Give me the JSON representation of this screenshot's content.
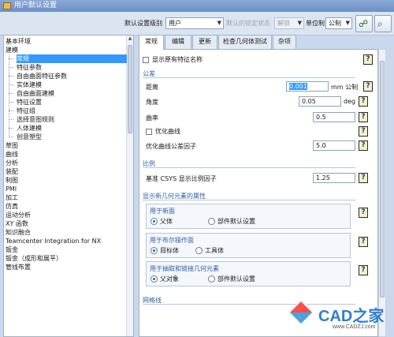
{
  "window": {
    "title": "用户默认设置"
  },
  "toolbar": {
    "level_label": "默认设置级别",
    "level_value": "用户",
    "lock_label": "默认的锁定状态",
    "lock_value": "解锁",
    "unit_label": "单位制",
    "unit_value": "公制"
  },
  "tree": {
    "items": [
      {
        "label": "基本环境",
        "level": 0
      },
      {
        "label": "建模",
        "level": 0
      },
      {
        "label": "常规",
        "level": 1,
        "selected": true
      },
      {
        "label": "特征参数",
        "level": 1
      },
      {
        "label": "自由曲面特征参数",
        "level": 1
      },
      {
        "label": "实体建模",
        "level": 1
      },
      {
        "label": "自由曲面建模",
        "level": 1
      },
      {
        "label": "特征设置",
        "level": 1
      },
      {
        "label": "特征组",
        "level": 1
      },
      {
        "label": "选择意图规则",
        "level": 1
      },
      {
        "label": "人体建模",
        "level": 1
      },
      {
        "label": "创意塑型",
        "level": 1
      },
      {
        "label": "草图",
        "level": 0
      },
      {
        "label": "曲线",
        "level": 0
      },
      {
        "label": "分析",
        "level": 0
      },
      {
        "label": "装配",
        "level": 0
      },
      {
        "label": "制图",
        "level": 0
      },
      {
        "label": "PMI",
        "level": 0
      },
      {
        "label": "加工",
        "level": 0
      },
      {
        "label": "仿真",
        "level": 0
      },
      {
        "label": "运动分析",
        "level": 0
      },
      {
        "label": "XY 函数",
        "level": 0
      },
      {
        "label": "知识融合",
        "level": 0
      },
      {
        "label": "Teamcenter Integration for NX",
        "level": 0
      },
      {
        "label": "钣金",
        "level": 0
      },
      {
        "label": "钣金（成形和展平）",
        "level": 0
      },
      {
        "label": "管线布置",
        "level": 0
      }
    ]
  },
  "tabs": [
    "常规",
    "编辑",
    "更新",
    "检查几何体测试",
    "杂项"
  ],
  "general": {
    "show_feature_names": "显示原有特征名称",
    "tolerance_section": "公差",
    "distance_label": "距离",
    "distance_value": "0.001",
    "distance_unit": "mm 公制",
    "angle_label": "角度",
    "angle_value": "0.05",
    "angle_unit": "deg",
    "curvature_label": "曲率",
    "curvature_value": "0.5",
    "optimize_curve_label": "优化曲线",
    "optimize_tol_label": "优化曲线公差因子",
    "optimize_tol_value": "5.0",
    "scale_section": "比例",
    "csys_label": "基准 CSYS 显示比例因子",
    "csys_value": "1.25",
    "new_geom_section": "显示新几何元素的属性",
    "new_face_group": "用于新面",
    "parent_label": "父体",
    "part_default_label": "部件默认设置",
    "boolean_group": "用于布尔操作面",
    "target_label": "目标体",
    "tool_label": "工具体",
    "extract_group": "用于抽取和链接几何元素",
    "parent_obj_label": "父对象",
    "part_default_label_2": "部件默认设置",
    "mesh_section": "网格线",
    "help_glyph": "?"
  },
  "watermark": {
    "brand": "CAD之家",
    "url": "www.CADZJ.com"
  }
}
